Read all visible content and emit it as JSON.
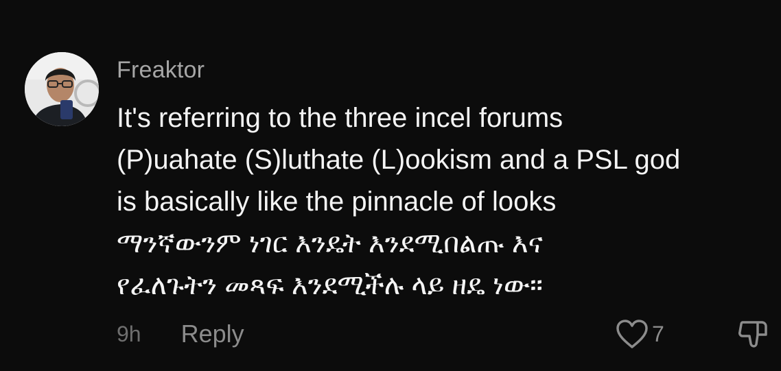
{
  "comment": {
    "username": "Freaktor",
    "text": "It's referring to the three incel forums\n(P)uahate (S)luthate (L)ookism and a PSL god\nis basically like the pinnacle of looks\nማንኛውንም ነገር እንዴት እንደሚበልጡ እና\nየፈለጉትን መጻፍ እንደሚችሉ ላይ ዘዴ ነው።",
    "timestamp": "9h",
    "reply_label": "Reply",
    "like_count": "7",
    "icons": {
      "avatar": "user-avatar",
      "like": "heart-icon",
      "dislike": "thumbs-down-icon"
    },
    "colors": {
      "background": "#0c0c0c",
      "text": "#f4f4f4",
      "muted": "#8c8c8c",
      "username": "#a6a6a6"
    }
  }
}
